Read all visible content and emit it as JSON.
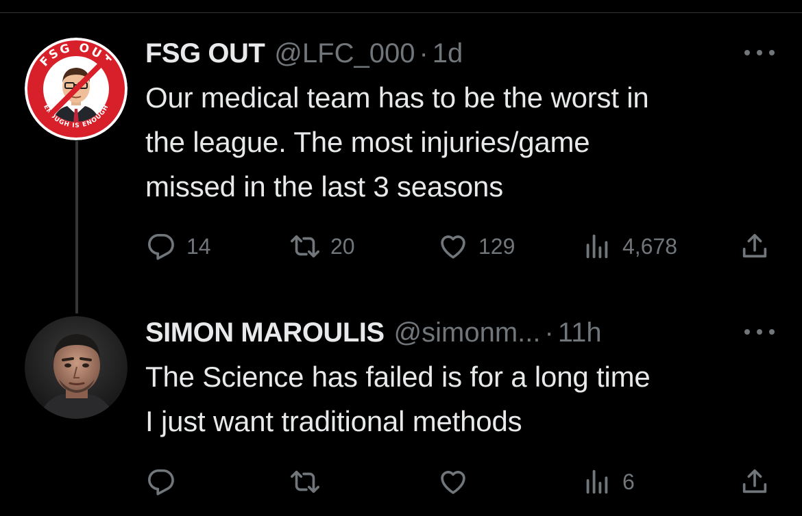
{
  "tweets": [
    {
      "display_name": "FSG OUT",
      "handle": "@LFC_000",
      "separator": "·",
      "time": "1d",
      "avatar": {
        "icon": "fsg-out-logo-avatar",
        "ring_text_top": "FSG OUT",
        "ring_text_bottom": "ENOUGH IS ENOUGH"
      },
      "text_lines": [
        "Our medical team has to be the worst in",
        "the league. The most injuries/game",
        "missed in the last 3 seasons"
      ],
      "actions": {
        "replies": "14",
        "retweets": "20",
        "likes": "129",
        "views": "4,678"
      }
    },
    {
      "display_name": "SIMON MAROULIS",
      "handle": "@simonm...",
      "separator": "·",
      "time": "11h",
      "avatar": {
        "icon": "user-photo-avatar"
      },
      "text_lines": [
        "The Science has failed is for a long time",
        "I just want traditional methods"
      ],
      "actions": {
        "replies": "",
        "retweets": "",
        "likes": "",
        "views": "6"
      }
    }
  ],
  "icons": {
    "reply": "reply-icon",
    "retweet": "retweet-icon",
    "like": "heart-icon",
    "views": "views-icon",
    "share": "share-icon",
    "more": "more-icon"
  },
  "colors": {
    "background": "#000000",
    "text_primary": "#e7e9ea",
    "text_secondary": "#71767b",
    "logo_red": "#d8202a"
  }
}
